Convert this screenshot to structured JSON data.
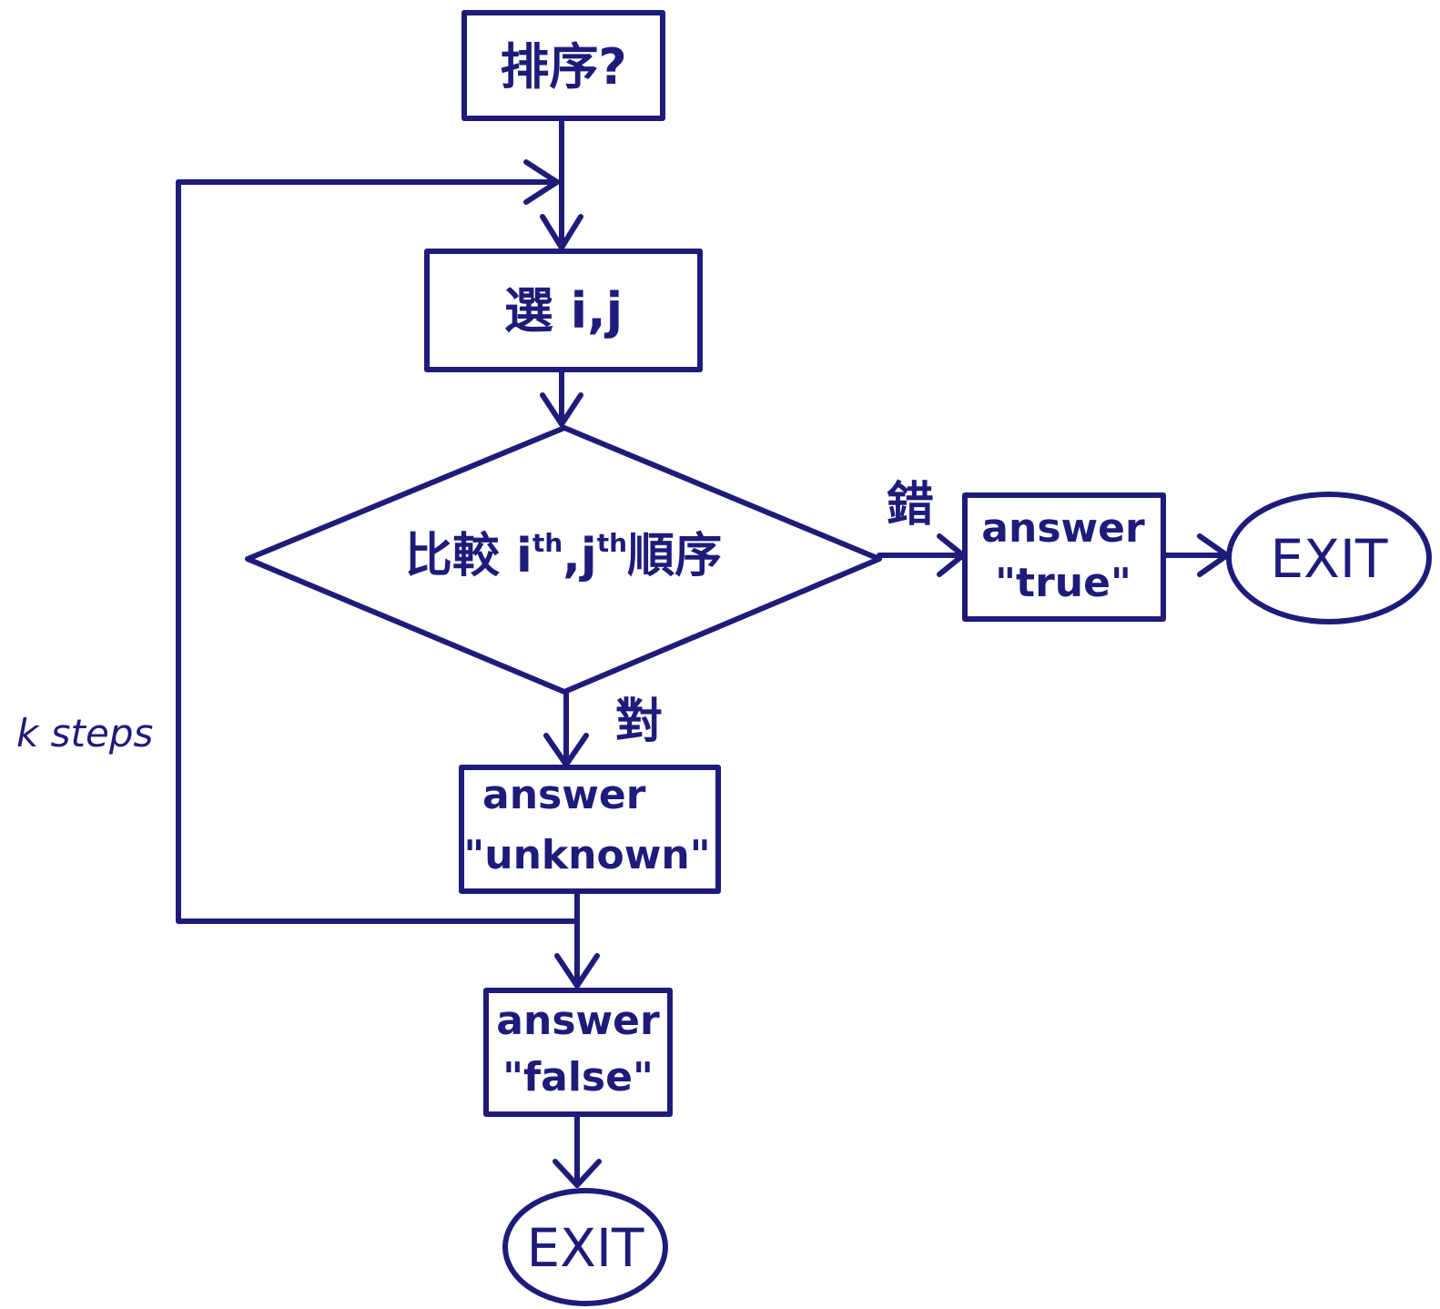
{
  "diagram": {
    "type": "flowchart",
    "nodes": {
      "start": {
        "label": "排序?"
      },
      "select": {
        "label": "選 i,j"
      },
      "compare": {
        "prefix": "比較 ",
        "i": "i",
        "sep": ",",
        "j": "j",
        "sup": "th",
        "suffix": "順序"
      },
      "answer_true": {
        "line1": "answer",
        "line2": "\"true\""
      },
      "exit_right": {
        "label": "EXIT"
      },
      "answer_unknown": {
        "line1": "answer",
        "line2": "\"unknown\""
      },
      "answer_false": {
        "line1": "answer",
        "line2": "\"false\""
      },
      "exit_bottom": {
        "label": "EXIT"
      }
    },
    "edges": {
      "wrong": {
        "label": "錯"
      },
      "right": {
        "label": "對"
      },
      "loop": {
        "label": "k steps"
      }
    },
    "colors": {
      "stroke": "#1f1b7a",
      "background": "#ffffff"
    }
  }
}
